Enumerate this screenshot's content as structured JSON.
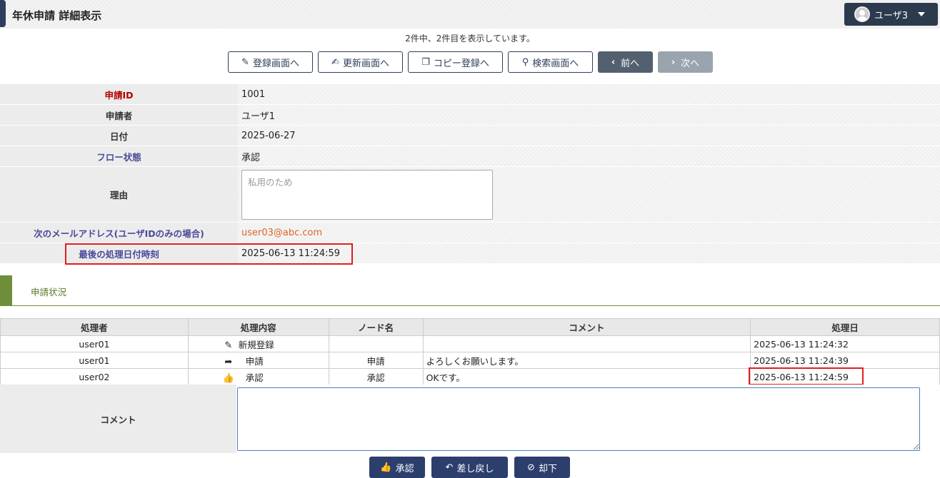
{
  "header": {
    "title": "年休申請 詳細表示"
  },
  "user_menu": {
    "name": "ユーザ3"
  },
  "record_count": "2件中、2件目を表示しています。",
  "nav": {
    "register": "登録画面へ",
    "update": "更新画面へ",
    "copy": "コピー登録へ",
    "search": "検索画面へ",
    "prev": "前へ",
    "next": "次へ"
  },
  "detail": {
    "request_id_label": "申請ID",
    "request_id": "1001",
    "applicant_label": "申請者",
    "applicant": "ユーザ1",
    "date_label": "日付",
    "date": "2025-06-27",
    "flow_label": "フロー状態",
    "flow": "承認",
    "reason_label": "理由",
    "reason_placeholder": "私用のため",
    "next_mail_label": "次のメールアドレス(ユーザIDのみの場合)",
    "next_mail": "user03@abc.com",
    "last_processed_label": "最後の処理日付時刻",
    "last_processed": "2025-06-13 11:24:59"
  },
  "section": {
    "title": "申請状況"
  },
  "history": {
    "headers": [
      "処理者",
      "処理内容",
      "ノード名",
      "コメント",
      "処理日"
    ],
    "rows": [
      {
        "user": "user01",
        "icon": "pencil-icon",
        "action": "新規登録",
        "node": "",
        "comment": "",
        "date": "2025-06-13 11:24:32"
      },
      {
        "user": "user01",
        "icon": "share-arrow-icon",
        "action": "申請",
        "node": "申請",
        "comment": "よろしくお願いします。",
        "date": "2025-06-13 11:24:39"
      },
      {
        "user": "user02",
        "icon": "thumbs-up-icon",
        "action": "承認",
        "node": "承認",
        "comment": "OKです。",
        "date": "2025-06-13 11:24:59"
      }
    ]
  },
  "comment": {
    "label": "コメント",
    "value": ""
  },
  "actions": {
    "approve": "承認",
    "send_back": "差し戻し",
    "reject": "却下"
  },
  "colors": {
    "primary": "#2c3e6c",
    "highlight": "#e01e1e",
    "section_accent": "#6f8e3a",
    "mail": "#e0642a",
    "required_label": "#b30000"
  }
}
